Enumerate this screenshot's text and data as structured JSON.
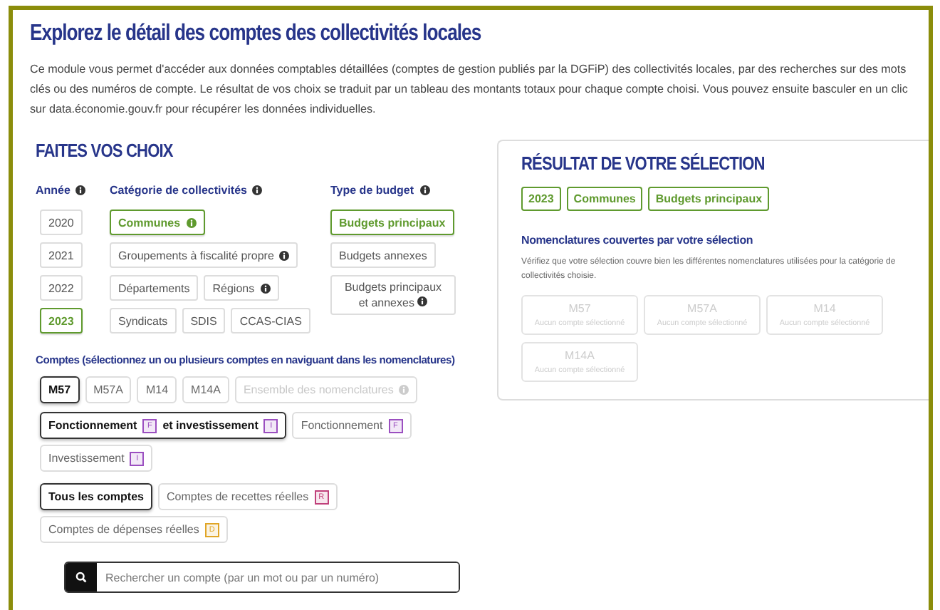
{
  "title": "Explorez le détail des comptes des collectivités locales",
  "intro": "Ce module vous permet d'accéder aux données comptables détaillées (comptes de gestion publiés par la DGFiP) des collectivités locales, par des recherches sur des mots clés ou des numéros de compte. Le résultat de vos choix se traduit par un tableau des montants totaux pour chaque compte choisi. Vous pouvez ensuite basculer en un clic sur data.économie.gouv.fr pour récupérer les données individuelles.",
  "choices": {
    "heading": "FAITES VOS CHOIX",
    "years": {
      "label": "Année",
      "items": [
        {
          "label": "2020",
          "selected": false
        },
        {
          "label": "2021",
          "selected": false
        },
        {
          "label": "2022",
          "selected": false
        },
        {
          "label": "2023",
          "selected": true
        }
      ]
    },
    "categories": {
      "label": "Catégorie de collectivités",
      "rows": [
        [
          {
            "label": "Communes",
            "info": true,
            "selected": true
          }
        ],
        [
          {
            "label": "Groupements à fiscalité propre",
            "info": true,
            "selected": false
          }
        ],
        [
          {
            "label": "Départements",
            "info": false,
            "selected": false
          },
          {
            "label": "Régions",
            "info": true,
            "selected": false
          }
        ],
        [
          {
            "label": "Syndicats",
            "info": false,
            "selected": false
          },
          {
            "label": "SDIS",
            "info": false,
            "selected": false
          },
          {
            "label": "CCAS-CIAS",
            "info": false,
            "selected": false
          }
        ]
      ]
    },
    "budgets": {
      "label": "Type de budget",
      "items": [
        {
          "label": "Budgets principaux",
          "info": false,
          "selected": true
        },
        {
          "label": "Budgets annexes",
          "info": false,
          "selected": false
        },
        {
          "label": "Budgets principaux et annexes",
          "info": true,
          "selected": false
        }
      ]
    }
  },
  "accounts": {
    "label": "Comptes (sélectionnez un ou plusieurs comptes en naviguant dans les nomenclatures)",
    "nomenclatures": [
      {
        "label": "M57",
        "selected": true,
        "disabled": false,
        "info": false
      },
      {
        "label": "M57A",
        "selected": false,
        "disabled": false,
        "info": false
      },
      {
        "label": "M14",
        "selected": false,
        "disabled": false,
        "info": false
      },
      {
        "label": "M14A",
        "selected": false,
        "disabled": false,
        "info": false
      },
      {
        "label": "Ensemble des nomenclatures",
        "selected": false,
        "disabled": true,
        "info": true
      }
    ],
    "scopes": [
      {
        "selected": true,
        "segments": [
          {
            "kind": "text",
            "text": "Fonctionnement"
          },
          {
            "kind": "badge",
            "letter": "F",
            "color": "#9b4fc0"
          },
          {
            "kind": "text",
            "text": "et investissement"
          },
          {
            "kind": "badge",
            "letter": "I",
            "color": "#9b4fc0"
          }
        ]
      },
      {
        "selected": false,
        "segments": [
          {
            "kind": "text",
            "text": "Fonctionnement"
          },
          {
            "kind": "badge",
            "letter": "F",
            "color": "#9b4fc0"
          }
        ]
      },
      {
        "selected": false,
        "segments": [
          {
            "kind": "text",
            "text": "Investissement"
          },
          {
            "kind": "badge",
            "letter": "I",
            "color": "#9b4fc0"
          }
        ]
      }
    ],
    "types": [
      {
        "selected": true,
        "segments": [
          {
            "kind": "text",
            "text": "Tous les comptes"
          }
        ]
      },
      {
        "selected": false,
        "segments": [
          {
            "kind": "text",
            "text": "Comptes de recettes réelles"
          },
          {
            "kind": "badge",
            "letter": "R",
            "color": "#c0407a"
          }
        ]
      },
      {
        "selected": false,
        "segments": [
          {
            "kind": "text",
            "text": "Comptes de dépenses réelles"
          },
          {
            "kind": "badge",
            "letter": "D",
            "color": "#e0a526"
          }
        ]
      }
    ],
    "search": {
      "placeholder": "Rechercher un compte (par un mot ou par un numéro)"
    }
  },
  "result": {
    "heading": "RÉSULTAT DE VOTRE SÉLECTION",
    "tags": [
      "2023",
      "Communes",
      "Budgets principaux"
    ],
    "nomenclature_heading": "Nomenclatures couvertes par votre sélection",
    "note": "Vérifiez que votre sélection couvre bien les différentes nomenclatures utilisées pour la catégorie de collectivités choisie.",
    "cards": [
      {
        "code": "M57",
        "status": "Aucun compte sélectionné"
      },
      {
        "code": "M57A",
        "status": "Aucun compte sélectionné"
      },
      {
        "code": "M14",
        "status": "Aucun compte sélectionné"
      },
      {
        "code": "M14A",
        "status": "Aucun compte sélectionné"
      }
    ]
  }
}
